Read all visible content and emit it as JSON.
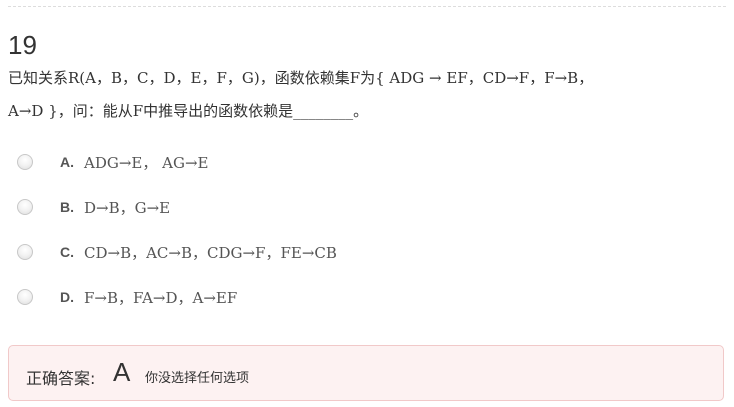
{
  "question": {
    "number": "19",
    "line1": "已知关系R(A，B，C，D，E，F，G)，函数依赖集F为{ ADG → EF，CD→F，F→B，",
    "line2": "A→D }，问：能从F中推导出的函数依赖是________。"
  },
  "options": [
    {
      "letter": "A.",
      "text": "ADG→E， AG→E"
    },
    {
      "letter": "B.",
      "text": "D→B，G→E"
    },
    {
      "letter": "C.",
      "text": "CD→B，AC→B，CDG→F，FE→CB"
    },
    {
      "letter": "D.",
      "text": "F→B，FA→D，A→EF"
    }
  ],
  "answer": {
    "label": "正确答案:",
    "value": "A",
    "note": "你没选择任何选项"
  }
}
